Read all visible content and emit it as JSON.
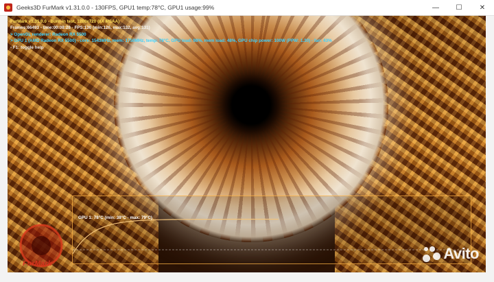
{
  "window": {
    "title": "Geeks3D FurMark v1.31.0.0 - 130FPS, GPU1 temp:78°C, GPU1 usage:99%",
    "minimize_glyph": "—",
    "maximize_glyph": "☐",
    "close_glyph": "✕"
  },
  "hud": {
    "lines": [
      "FurMark v1.31.0.0 - Burn-in test, 1280x720 (8X MSAA)",
      "Frames:66493 - time:00:08:28 - FPS:130 (min:126, max:132, avg:131)",
      "> OpenGL renderer: Radeon RX 5500",
      "> GPU 1 (AMD Radeon RX 5500) - core: 1543MHz, mem: 1750MHz, temp: 78°C, GPU load: 98%, mem load: 48%, GPU chip power: 100W (PPW: 1.30) - fan: 43%",
      "- F1: toggle help"
    ]
  },
  "graph": {
    "label": "GPU 1: 78°C (min: 38°C - max: 79°C)",
    "current_temp_c": 78,
    "min_temp_c": 38,
    "max_temp_c": 79
  },
  "logo": {
    "text": "FurMark"
  },
  "watermark": {
    "text": "Avito"
  },
  "colors": {
    "hud_yellow": "#ffe25a",
    "hud_cyan": "#3ed3ff",
    "graph_line": "#f1c27a",
    "graph_border": "#ffb446"
  }
}
